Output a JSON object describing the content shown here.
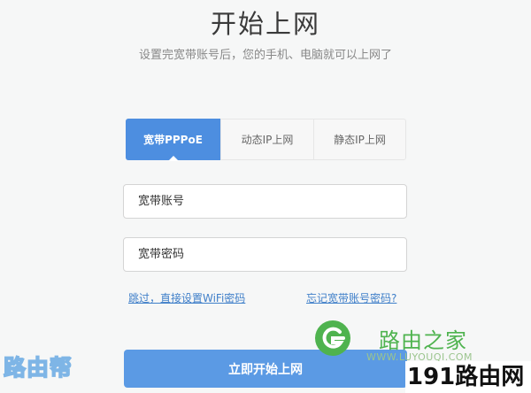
{
  "header": {
    "title": "开始上网",
    "subtitle": "设置完宽带账号后，您的手机、电脑就可以上网了"
  },
  "tabs": [
    {
      "label": "宽带PPPoE",
      "active": true
    },
    {
      "label": "动态IP上网",
      "active": false
    },
    {
      "label": "静态IP上网",
      "active": false
    }
  ],
  "form": {
    "account_placeholder": "宽带账号",
    "password_placeholder": "宽带密码",
    "skip_link": "跳过，直接设置WiFi密码",
    "forgot_link": "忘记宽带账号密码?",
    "submit_label": "立即开始上网"
  },
  "watermarks": {
    "left_text": "路由帮",
    "brand_text": "路由之家",
    "brand_url": "WWW.LUYOUQI.COM",
    "right_text": "191路由网"
  },
  "colors": {
    "accent": "#4d8ee0",
    "button": "#5b9ae4",
    "link": "#3f7fc9"
  }
}
